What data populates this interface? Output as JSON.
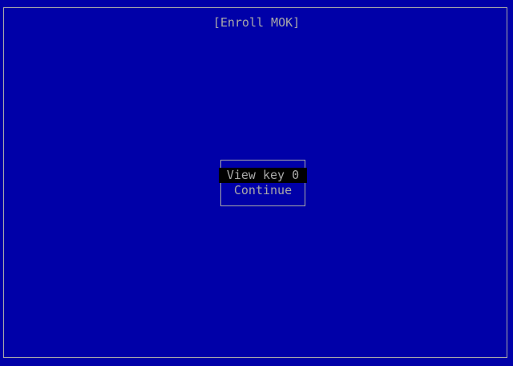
{
  "screen": {
    "title": "[Enroll MOK]"
  },
  "menu": {
    "items": [
      {
        "label": "View key 0",
        "selected": true
      },
      {
        "label": "Continue",
        "selected": false
      }
    ]
  },
  "colors": {
    "background": "#0000a8",
    "foreground": "#a8a8a8",
    "selection_background": "#000000"
  }
}
